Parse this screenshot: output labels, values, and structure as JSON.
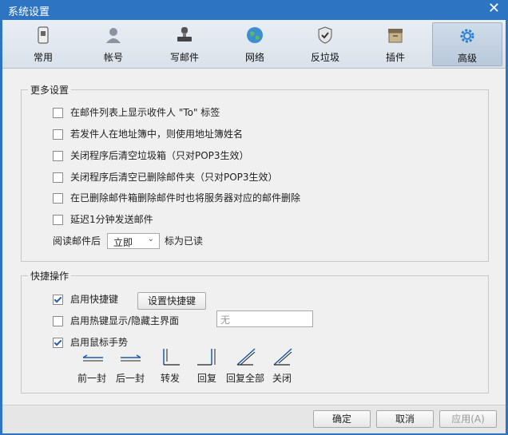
{
  "window": {
    "title": "系统设置"
  },
  "tabs": [
    {
      "label": "常用",
      "icon": "phone-icon"
    },
    {
      "label": "帐号",
      "icon": "user-icon"
    },
    {
      "label": "写邮件",
      "icon": "stamp-icon"
    },
    {
      "label": "网络",
      "icon": "globe-icon"
    },
    {
      "label": "反垃圾",
      "icon": "shield-icon"
    },
    {
      "label": "插件",
      "icon": "box-icon"
    },
    {
      "label": "高级",
      "icon": "gear-icon",
      "active": true
    }
  ],
  "more_settings": {
    "legend": "更多设置",
    "options": [
      {
        "label": "在邮件列表上显示收件人 \"To\" 标签",
        "checked": false
      },
      {
        "label": "若发件人在地址簿中，则使用地址簿姓名",
        "checked": false
      },
      {
        "label": "关闭程序后清空垃圾箱（只对POP3生效）",
        "checked": false
      },
      {
        "label": "关闭程序后清空已删除邮件夹（只对POP3生效）",
        "checked": false
      },
      {
        "label": "在已删除邮件箱删除邮件时也将服务器对应的邮件删除",
        "checked": false
      },
      {
        "label": "延迟1分钟发送邮件",
        "checked": false
      }
    ],
    "read_prefix": "阅读邮件后",
    "read_select_value": "立即",
    "read_suffix": "标为已读"
  },
  "shortcuts": {
    "legend": "快捷操作",
    "enable_hotkeys_label": "启用快捷键",
    "enable_hotkeys_checked": true,
    "set_hotkeys_button": "设置快捷键",
    "hotkey_toggle_label": "启用热键显示/隐藏主界面",
    "hotkey_toggle_checked": false,
    "hotkey_value": "无",
    "mouse_gesture_label": "启用鼠标手势",
    "mouse_gesture_checked": true,
    "gestures": [
      {
        "label": "前一封"
      },
      {
        "label": "后一封"
      },
      {
        "label": "转发"
      },
      {
        "label": "回复"
      },
      {
        "label": "回复全部"
      },
      {
        "label": "关闭"
      }
    ]
  },
  "footer": {
    "ok": "确定",
    "cancel": "取消",
    "apply": "应用(A)"
  },
  "colors": {
    "titlebar": "#2d74c3",
    "check": "#2a5fa8"
  }
}
